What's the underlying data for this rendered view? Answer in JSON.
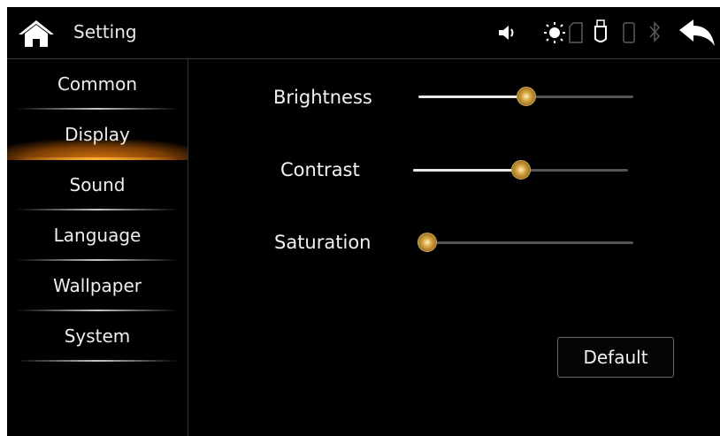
{
  "header": {
    "title": "Setting",
    "status_icons": [
      "volume-icon",
      "brightness-icon",
      "sd-card-icon",
      "usb-icon",
      "phone-icon",
      "bluetooth-icon"
    ],
    "back_icon": "back-arrow-icon"
  },
  "sidebar": {
    "items": [
      {
        "label": "Common"
      },
      {
        "label": "Display"
      },
      {
        "label": "Sound"
      },
      {
        "label": "Language"
      },
      {
        "label": "Wallpaper"
      },
      {
        "label": "System"
      }
    ],
    "active_index": 1
  },
  "display": {
    "brightness": {
      "label": "Brightness",
      "level": 0.5
    },
    "contrast": {
      "label": "Contrast",
      "level": 0.5
    },
    "saturation": {
      "label": "Saturation",
      "level": 0.0
    },
    "default_label": "Default"
  },
  "colors": {
    "accent": "#d9780e",
    "background": "#000000",
    "text": "#f2f2f2",
    "thumb": "#d7a53e"
  }
}
